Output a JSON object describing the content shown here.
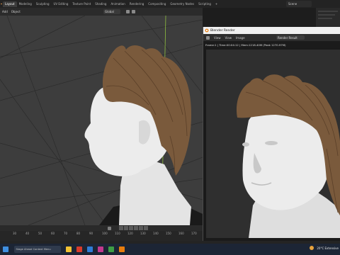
{
  "workspace_tabs": [
    "Layout",
    "Modeling",
    "Sculpting",
    "UV Editing",
    "Texture Paint",
    "Shading",
    "Animation",
    "Rendering",
    "Compositing",
    "Geometry Nodes",
    "Scripting"
  ],
  "active_tab": "Layout",
  "scene_name": "Scene",
  "viewport_menus": [
    "Add",
    "Object"
  ],
  "transform_orientation": "Global",
  "render_window": {
    "title": "Blender Render",
    "menus": [
      "View",
      "View",
      "Image"
    ],
    "slot": "Render Result",
    "info": "Frame:1 | Time:00:04:12 | Mem:1218.40M (Peak 1270.97M)"
  },
  "timeline": {
    "ticks": [
      "30",
      "40",
      "50",
      "60",
      "70",
      "80",
      "90",
      "100",
      "110",
      "120",
      "130",
      "140",
      "150",
      "160",
      "170"
    ]
  },
  "taskbar": {
    "search_placeholder": "Stage Ahead Context Menu",
    "weather": "20°C Extensive"
  },
  "colors": {
    "viewport_bg": "#3d3d3d",
    "render_bg": "#2f2f2f",
    "hair": "#7a5a3c",
    "skin": "#e6e6e6",
    "taskbar": "#1c2535"
  }
}
